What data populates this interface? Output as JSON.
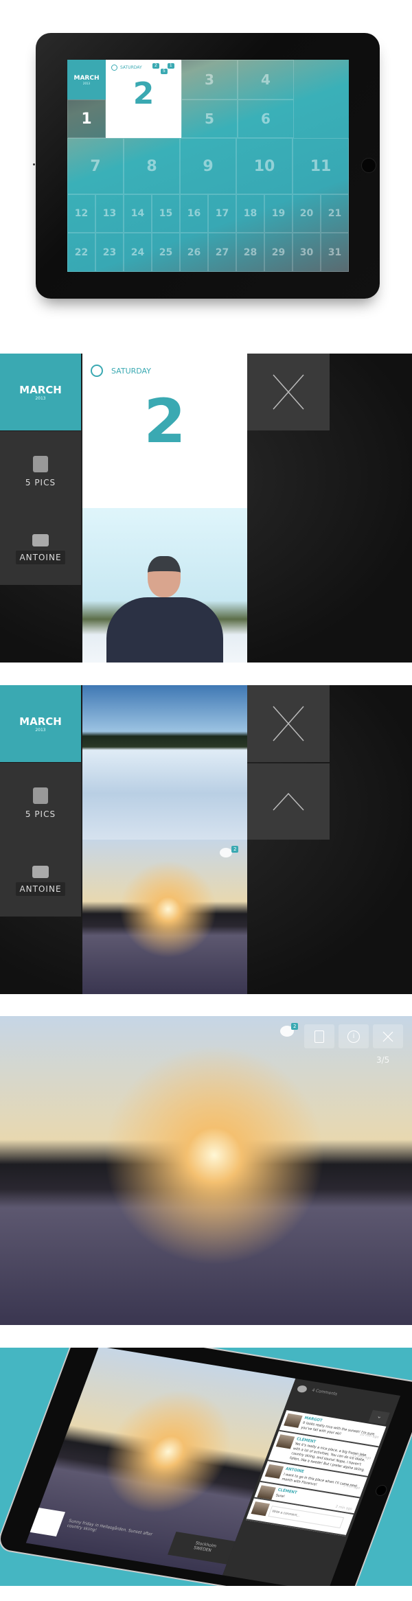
{
  "accent": "#3aa9b2",
  "calendar": {
    "month": "MARCH",
    "year": "2013",
    "weekday": "SATURDAY",
    "selected_day": "2",
    "first_day": "1",
    "day_badges": [
      "2",
      "1",
      "5"
    ],
    "row1": [
      "3",
      "4"
    ],
    "row2": [
      "5",
      "6"
    ],
    "row3": [
      "7",
      "8",
      "9",
      "10",
      "11"
    ],
    "row4": [
      "12",
      "13",
      "14",
      "15",
      "16",
      "17",
      "18",
      "19",
      "20",
      "21"
    ],
    "row5": [
      "22",
      "23",
      "24",
      "25",
      "26",
      "27",
      "28",
      "29",
      "30",
      "31"
    ]
  },
  "day_view": {
    "month": "MARCH",
    "year": "2013",
    "weekday": "SATURDAY",
    "day": "2",
    "pics_label": "5 PICS",
    "birthday_name": "ANTOINE",
    "comment_badge": "2"
  },
  "viewer": {
    "comment_badge": "2",
    "counter": "3/5",
    "icons": [
      "comments-icon",
      "add-note-icon",
      "info-icon",
      "close-icon"
    ]
  },
  "comments": {
    "count_label": "4 Comments",
    "items": [
      {
        "name": "MARGOT",
        "text": "It looks really nice with the sunset! I'm sure you've fall with your ski!",
        "time": "20 min ago"
      },
      {
        "name": "CLÉMENT",
        "text": "Yes it's really a nice place, a big frozen lake with a lot of activities. You can do ice skate, country skiing, and sauna! Nope, I haven't fallen, like a swede! But I prefer alpine skiing.",
        "time": "11 min ago"
      },
      {
        "name": "ANTOINE",
        "text": "I want to go in this place when I'll come next month with Florence!",
        "time": "5 min ago"
      },
      {
        "name": "CLÉMENT",
        "text": "Sure!",
        "time": "2 min ago"
      }
    ],
    "placeholder": "Write a comment..."
  },
  "caption": {
    "text": "Sunny friday in Hellasgården. Sunset after country skiing!",
    "city": "Stockholm",
    "country": "SWEDEN"
  }
}
